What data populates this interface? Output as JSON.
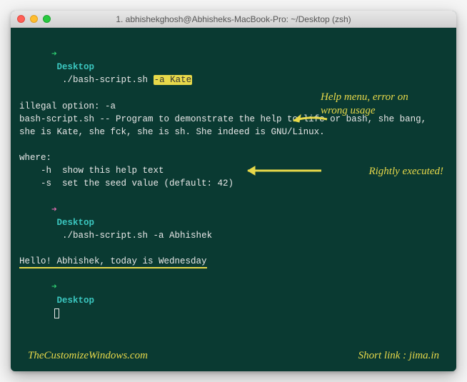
{
  "window": {
    "title": "1. abhishekghosh@Abhisheks-MacBook-Pro: ~/Desktop (zsh)"
  },
  "prompt1": {
    "arrow": "➜",
    "location": "Desktop",
    "command": "./bash-script.sh ",
    "flag": "-a Kate"
  },
  "output1": {
    "err": "illegal option: -a",
    "desc": "bash-script.sh -- Program to demonstrate the help to life or bash, she bang, she is Kate, she fck, she is sh. She indeed is GNU/Linux.",
    "where": "where:",
    "opt_h": "    -h  show this help text",
    "opt_s": "    -s  set the seed value (default: 42)"
  },
  "prompt2": {
    "arrow": "➜",
    "location": "Desktop",
    "command": "./bash-script.sh -a Abhishek"
  },
  "output2": {
    "msg": "Hello! Abhishek, today is Wednesday"
  },
  "prompt3": {
    "arrow": "➜",
    "location": "Desktop"
  },
  "annotations": {
    "help": "Help menu, error on wrong usage",
    "right": "Rightly executed!"
  },
  "footer": {
    "left": "TheCustomizeWindows.com",
    "right": "Short link : jima.in"
  }
}
